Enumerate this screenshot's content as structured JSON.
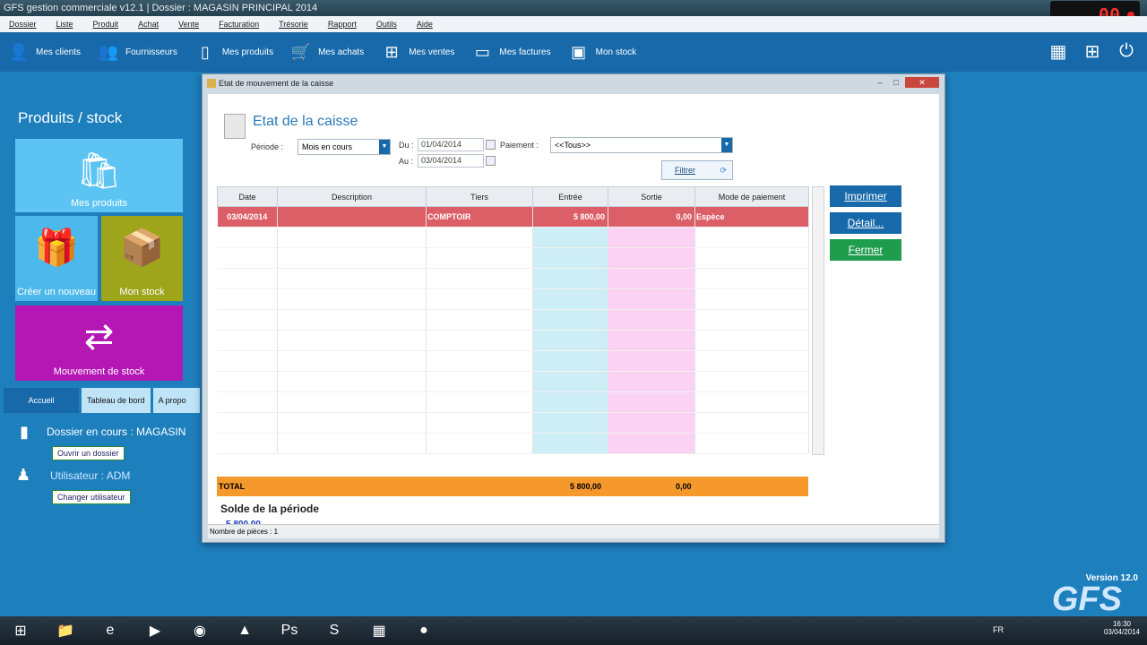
{
  "window": {
    "title": "GFS gestion commerciale v12.1 | Dossier : MAGASIN PRINCIPAL 2014"
  },
  "menu": [
    "Dossier",
    "Liste",
    "Produit",
    "Achat",
    "Vente",
    "Facturation",
    "Trésorie",
    "Rapport",
    "Outils",
    "Aide"
  ],
  "toolbar": {
    "items": [
      {
        "label": "Mes clients",
        "icon": "person-icon"
      },
      {
        "label": "Fournisseurs",
        "icon": "supplier-icon"
      },
      {
        "label": "Mes produits",
        "icon": "bag-icon"
      },
      {
        "label": "Mes achats",
        "icon": "cart-icon"
      },
      {
        "label": "Mes ventes",
        "icon": "plus-icon"
      },
      {
        "label": "Mes factures",
        "icon": "document-icon"
      },
      {
        "label": "Mon stock",
        "icon": "box-icon"
      }
    ],
    "right_icons": [
      "calculator-icon",
      "grid-icon",
      "power-icon"
    ]
  },
  "sidebar": {
    "title": "Produits / stock",
    "tiles": [
      {
        "label": "Mes produits"
      },
      {
        "label": "Créer un nouveau"
      },
      {
        "label": "Mon stock"
      },
      {
        "label": "Mouvement de stock"
      }
    ],
    "tabs": [
      "Accueil",
      "Tableau de bord",
      "A propo"
    ],
    "dossier": "Dossier en cours : MAGASIN",
    "open_btn": "Ouvrir un dossier",
    "user": "Utilisateur : ADM",
    "change_btn": "Changer utilisateur"
  },
  "dialog": {
    "title": "Etat de mouvement de la caisse",
    "heading": "Etat de la caisse",
    "periode_label": "Période :",
    "periode_value": "Mois en cours",
    "du_label": "Du :",
    "du_value": "01/04/2014",
    "au_label": "Au :",
    "au_value": "03/04/2014",
    "paiement_label": "Paiement :",
    "paiement_value": "<<Tous>>",
    "filtrer": "Filtrer",
    "columns": [
      "Date",
      "Description",
      "Tiers",
      "Entrée",
      "Sortie",
      "Mode de paiement"
    ],
    "rows": [
      {
        "date": "03/04/2014",
        "description": "",
        "tiers": "COMPTOIR",
        "entree": "5 800,00",
        "sortie": "0,00",
        "mode": "Espèce"
      }
    ],
    "total_label": "TOTAL",
    "total_entree": "5 800,00",
    "total_sortie": "0,00",
    "solde_label": "Solde de la période",
    "solde_value": "5 800,00",
    "status": "Nombre de pièces : 1",
    "buttons": {
      "print": "Imprimer",
      "detail": "Détail...",
      "close": "Fermer"
    }
  },
  "brand": {
    "version": "Version 12.0",
    "logo": "GFS"
  },
  "taskbar": {
    "lang": "FR",
    "time": "16:30",
    "date": "03/04/2014"
  },
  "colors": {
    "selected_row": "#dc5f68",
    "total_bar": "#f5992d",
    "entree_col": "#cdeef7",
    "sortie_col": "#fbd2f4",
    "print_btn": "#1769aa",
    "close_btn": "#1f9d4c"
  }
}
